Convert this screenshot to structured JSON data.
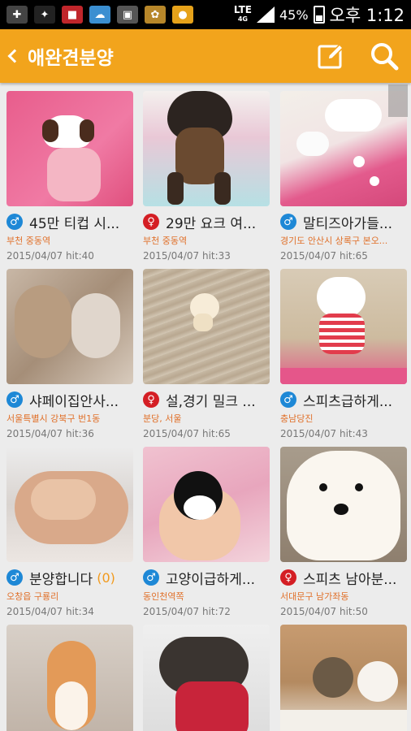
{
  "status_bar": {
    "network": "LTE",
    "network_sub": "4G",
    "battery": "45%",
    "time": "오후 1:12",
    "notification_icons": [
      "usb-icon",
      "satellite-icon",
      "stop-app-icon",
      "cloud-icon",
      "gallery-icon",
      "dog-app-icon",
      "map-pin-icon"
    ]
  },
  "app_bar": {
    "title": "애완견분양"
  },
  "colors": {
    "accent": "#f2a41c",
    "male": "#1e88d6",
    "female": "#d41e24",
    "location": "#e0702a"
  },
  "gender_symbols": {
    "male": "♂",
    "female": "♀"
  },
  "posts": [
    {
      "title": "45만 티컵 시...",
      "gender": "male",
      "location": "부천 중동역",
      "meta": "2015/04/07 hit:40",
      "count": ""
    },
    {
      "title": "29만 요크 여...",
      "gender": "female",
      "location": "부천 중동역",
      "meta": "2015/04/07 hit:33",
      "count": ""
    },
    {
      "title": "말티즈아가들...",
      "gender": "male",
      "location": "경기도 안산시 상록구 본오...",
      "meta": "2015/04/07 hit:65",
      "count": ""
    },
    {
      "title": "샤페이집안사...",
      "gender": "male",
      "location": "서울특별시 강북구 번1동",
      "meta": "2015/04/07 hit:36",
      "count": ""
    },
    {
      "title": "설,경기 밀크 ...",
      "gender": "female",
      "location": "분당, 서울",
      "meta": "2015/04/07 hit:65",
      "count": ""
    },
    {
      "title": "스피츠급하게...",
      "gender": "male",
      "location": "충남당진",
      "meta": "2015/04/07 hit:43",
      "count": ""
    },
    {
      "title": "분양합니다",
      "gender": "male",
      "location": "오창읍 구룡리",
      "meta": "2015/04/07 hit:34",
      "count": "(0)"
    },
    {
      "title": "고양이급하게...",
      "gender": "male",
      "location": "동인천역쪽",
      "meta": "2015/04/07 hit:72",
      "count": ""
    },
    {
      "title": "스피츠 남아분...",
      "gender": "female",
      "location": "서대문구 남가좌동",
      "meta": "2015/04/07 hit:50",
      "count": ""
    },
    {
      "title": "",
      "gender": "",
      "location": "",
      "meta": "",
      "count": ""
    },
    {
      "title": "",
      "gender": "",
      "location": "",
      "meta": "",
      "count": ""
    },
    {
      "title": "",
      "gender": "",
      "location": "",
      "meta": "",
      "count": ""
    }
  ]
}
